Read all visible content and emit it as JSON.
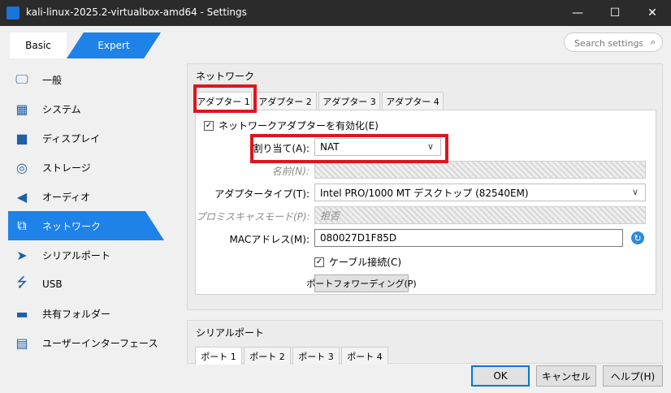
{
  "window": {
    "title": "kali-linux-2025.2-virtualbox-amd64 - Settings",
    "minimize_glyph": "—",
    "maximize_glyph": "☐",
    "close_glyph": "✕"
  },
  "mode": {
    "basic_label": "Basic",
    "expert_label": "Expert",
    "selected": "Expert"
  },
  "search": {
    "placeholder": "Search settings",
    "icon": "search-icon"
  },
  "sidebar": {
    "selected_index": 5,
    "items": [
      {
        "label": "一般",
        "icon": "monitor-icon"
      },
      {
        "label": "システム",
        "icon": "chip-icon"
      },
      {
        "label": "ディスプレイ",
        "icon": "display-icon"
      },
      {
        "label": "ストレージ",
        "icon": "disk-icon"
      },
      {
        "label": "オーディオ",
        "icon": "speaker-icon"
      },
      {
        "label": "ネットワーク",
        "icon": "network-icon"
      },
      {
        "label": "シリアルポート",
        "icon": "serial-port-icon"
      },
      {
        "label": "USB",
        "icon": "usb-icon"
      },
      {
        "label": "共有フォルダー",
        "icon": "folder-icon"
      },
      {
        "label": "ユーザーインターフェース",
        "icon": "ui-window-icon"
      }
    ]
  },
  "network": {
    "group_title": "ネットワーク",
    "tabs": [
      "アダプター 1",
      "アダプター 2",
      "アダプター 3",
      "アダプター 4"
    ],
    "active_tab": 0,
    "enable_adapter": {
      "label": "ネットワークアダプターを有効化(E)",
      "checked": true
    },
    "attached_to": {
      "label": "割り当て(A):",
      "value": "NAT"
    },
    "name": {
      "label": "名前(N):",
      "value": ""
    },
    "adapter_type": {
      "label": "アダプタータイプ(T):",
      "value": "Intel PRO/1000 MT デスクトップ (82540EM)"
    },
    "promiscuous": {
      "label": "プロミスキャスモード(P):",
      "value": "拒否"
    },
    "mac": {
      "label": "MACアドレス(M):",
      "value": "080027D1F85D"
    },
    "cable": {
      "label": "ケーブル接続(C)",
      "checked": true
    },
    "port_forwarding_label": "ポートフォワーディング(P)"
  },
  "serial": {
    "group_title": "シリアルポート",
    "tabs": [
      "ポート 1",
      "ポート 2",
      "ポート 3",
      "ポート 4"
    ],
    "active_tab": 0
  },
  "footer": {
    "ok": "OK",
    "cancel": "キャンセル",
    "help": "ヘルプ(H)"
  },
  "colors": {
    "accent": "#1e82e8",
    "highlight": "#e0141e",
    "titlebar": "#2b2b2b"
  }
}
